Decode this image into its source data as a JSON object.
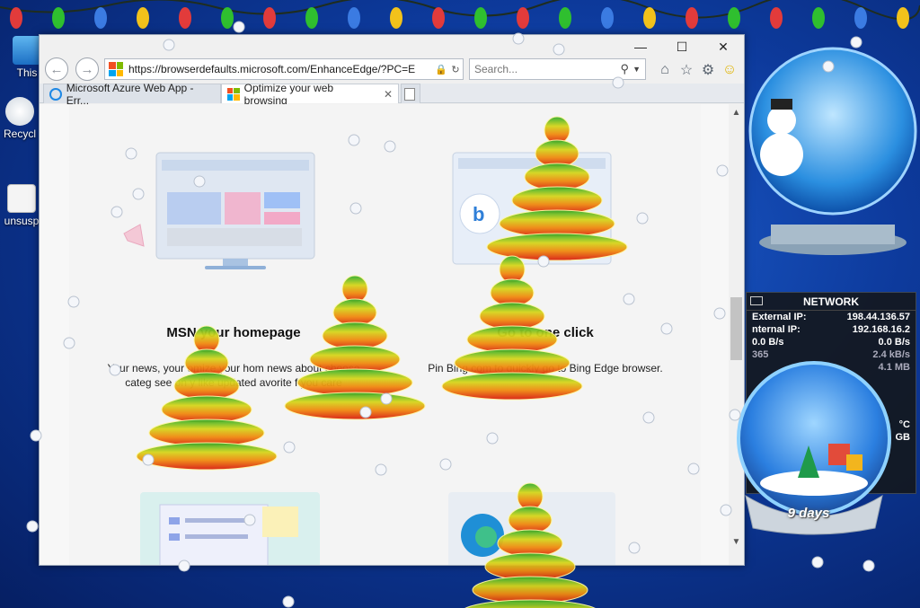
{
  "desktop": {
    "icons": [
      {
        "label": "This"
      },
      {
        "label": "Recycl"
      },
      {
        "label": "unsusp"
      }
    ]
  },
  "browser": {
    "address": {
      "url": "https://browserdefaults.microsoft.com/EnhanceEdge/?PC=E"
    },
    "search": {
      "placeholder": "Search..."
    },
    "tabs": [
      {
        "label": "Microsoft Azure Web App - Err...",
        "active": false
      },
      {
        "label": "Optimize your web browsing",
        "active": true
      }
    ],
    "cards": [
      {
        "title": "MSN your homepage",
        "text": "Your news, your omize your hom news about choose categ see on y like updated avorite f you care"
      },
      {
        "title": "Go to one click",
        "text": "Pin Bing.com to quickly go to Bing Edge browser."
      }
    ]
  },
  "network": {
    "title": "NETWORK",
    "rows": [
      {
        "label": "External IP:",
        "value": "198.44.136.57"
      },
      {
        "label": "nternal IP:",
        "value": "192.168.16.2"
      },
      {
        "label": "0.0 B/s",
        "value": "0.0 B/s"
      },
      {
        "label": "365",
        "value": "2.4 kB/s"
      },
      {
        "label": "",
        "value": "4.1 MB"
      }
    ],
    "temp_partial": "°C",
    "gb_partial": "GB"
  },
  "countdown": {
    "label": "9 days"
  },
  "colors": {
    "desktop_blue": "#0d3a9c",
    "window_chrome": "#f0f0f0",
    "gadget_bg": "#14181e"
  }
}
